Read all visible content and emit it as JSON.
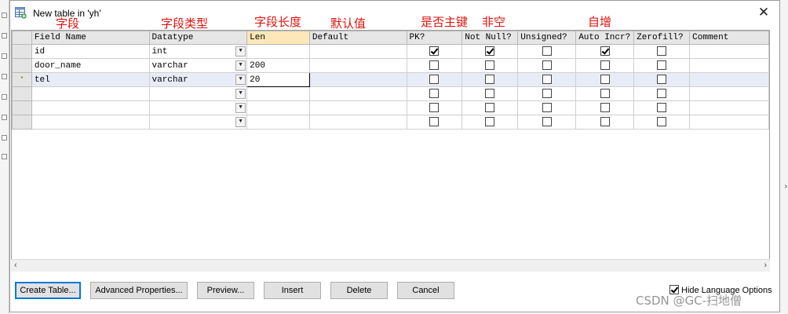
{
  "window": {
    "title": "New table in 'yh'",
    "close": "✕"
  },
  "annotations": {
    "field": "字段",
    "datatype": "字段类型",
    "length": "字段长度",
    "default": "默认值",
    "primary_key": "是否主键",
    "not_null": "非空",
    "auto_increment": "自增"
  },
  "grid": {
    "columns": [
      "Field Name",
      "Datatype",
      "Len",
      "Default",
      "PK?",
      "Not Null?",
      "Unsigned?",
      "Auto Incr?",
      "Zerofill?",
      "Comment"
    ],
    "rows": [
      {
        "marker": "",
        "field": "id",
        "datatype": "int",
        "len": "",
        "default": "",
        "pk": true,
        "notnull": true,
        "unsigned": false,
        "autoincr": true,
        "zerofill": false,
        "comment": ""
      },
      {
        "marker": "",
        "field": "door_name",
        "datatype": "varchar",
        "len": "200",
        "default": "",
        "pk": false,
        "notnull": false,
        "unsigned": false,
        "autoincr": false,
        "zerofill": false,
        "comment": ""
      },
      {
        "marker": "*",
        "field": "tel",
        "datatype": "varchar",
        "len": "20",
        "default": "",
        "pk": false,
        "notnull": false,
        "unsigned": false,
        "autoincr": false,
        "zerofill": false,
        "comment": ""
      },
      {
        "marker": "",
        "field": "",
        "datatype": "",
        "len": "",
        "default": "",
        "pk": false,
        "notnull": false,
        "unsigned": false,
        "autoincr": false,
        "zerofill": false,
        "comment": ""
      },
      {
        "marker": "",
        "field": "",
        "datatype": "",
        "len": "",
        "default": "",
        "pk": false,
        "notnull": false,
        "unsigned": false,
        "autoincr": false,
        "zerofill": false,
        "comment": ""
      },
      {
        "marker": "",
        "field": "",
        "datatype": "",
        "len": "",
        "default": "",
        "pk": false,
        "notnull": false,
        "unsigned": false,
        "autoincr": false,
        "zerofill": false,
        "comment": ""
      }
    ]
  },
  "buttons": {
    "create_table": "Create Table...",
    "advanced_properties": "Advanced Properties...",
    "preview": "Preview...",
    "insert": "Insert",
    "delete": "Delete",
    "cancel": "Cancel"
  },
  "hide_language_options": {
    "label": "Hide Language Options",
    "checked": true
  },
  "watermark": "CSDN @GC-扫地僧",
  "colors": {
    "annotation": "#e0140e",
    "len_header": "#fde7b8",
    "active_row": "#e8ecf7"
  }
}
